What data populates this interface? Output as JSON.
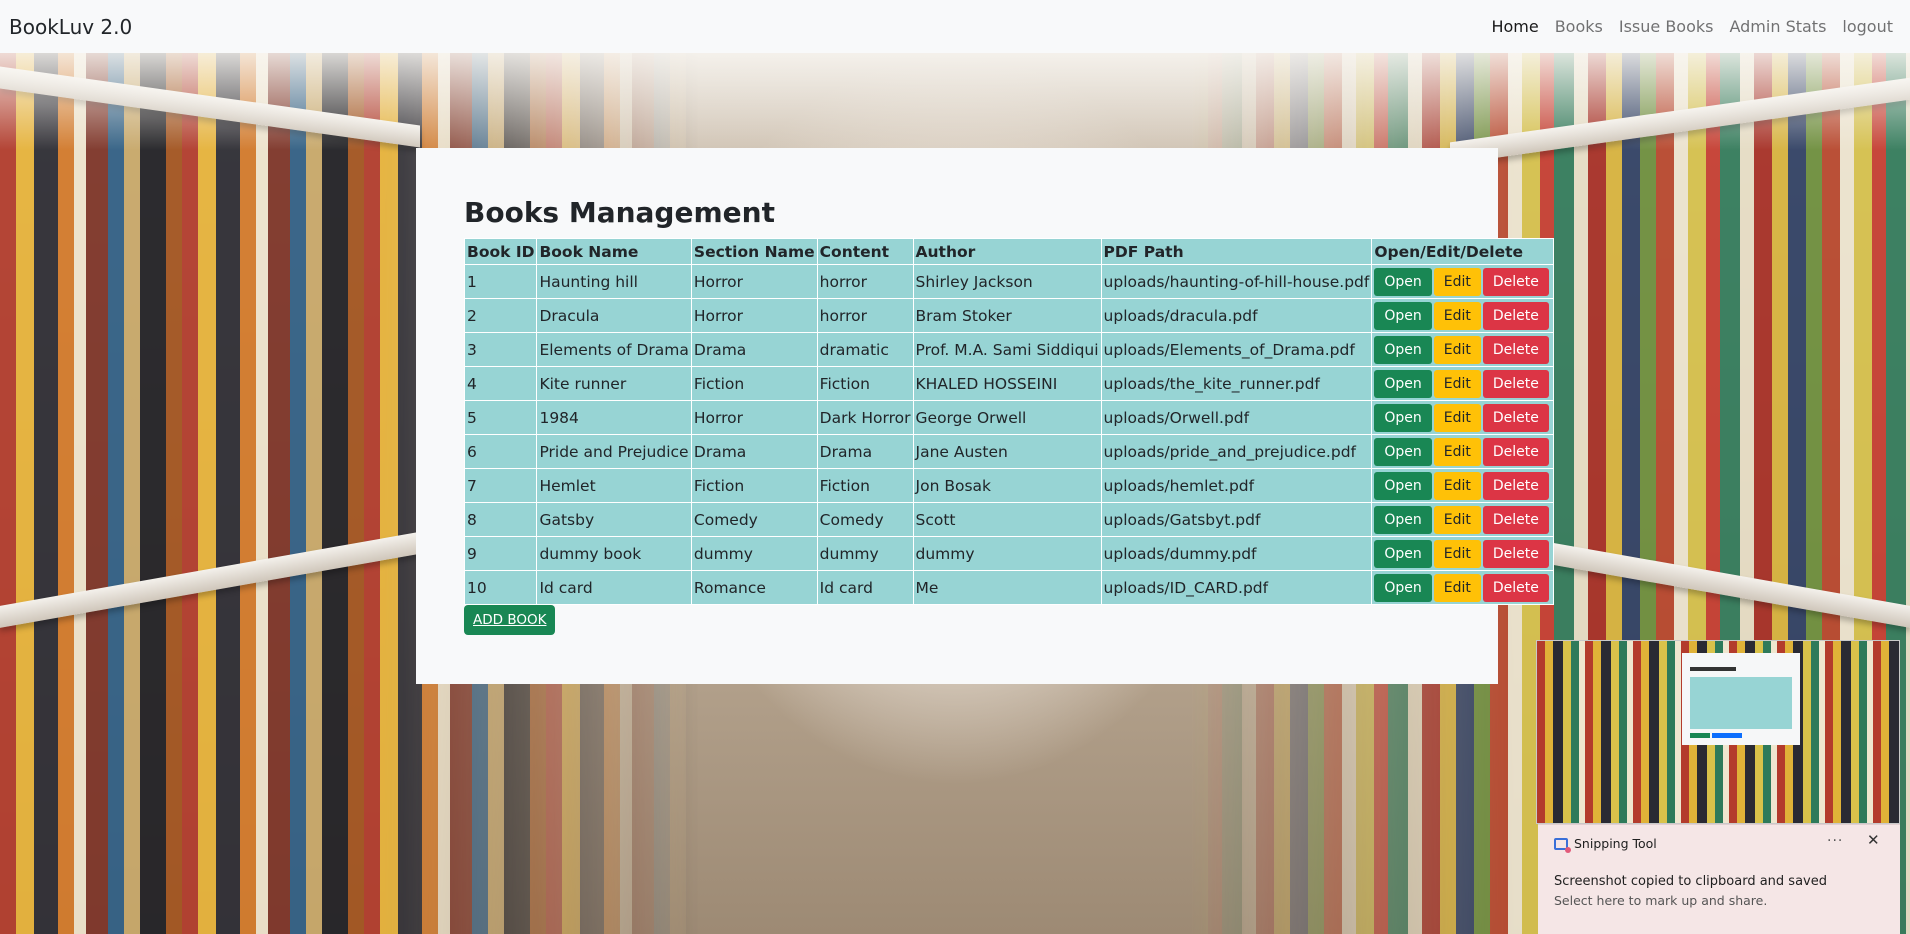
{
  "navbar": {
    "brand": "BookLuv 2.0",
    "links": [
      "Home",
      "Books",
      "Issue Books",
      "Admin Stats",
      "logout"
    ]
  },
  "main": {
    "title": "Books Management",
    "columns": [
      "Book ID",
      "Book Name",
      "Section Name",
      "Content",
      "Author",
      "PDF Path",
      "Open/Edit/Delete"
    ],
    "rows": [
      {
        "id": "1",
        "name": "Haunting hill",
        "section": "Horror",
        "content": "horror",
        "author": "Shirley Jackson",
        "pdf": "uploads/haunting-of-hill-house.pdf"
      },
      {
        "id": "2",
        "name": "Dracula",
        "section": "Horror",
        "content": "horror",
        "author": "Bram Stoker",
        "pdf": "uploads/dracula.pdf"
      },
      {
        "id": "3",
        "name": "Elements of Drama",
        "section": "Drama",
        "content": "dramatic",
        "author": "Prof. M.A. Sami Siddiqui",
        "pdf": "uploads/Elements_of_Drama.pdf"
      },
      {
        "id": "4",
        "name": "Kite runner",
        "section": "Fiction",
        "content": "Fiction",
        "author": "KHALED HOSSEINI",
        "pdf": "uploads/the_kite_runner.pdf"
      },
      {
        "id": "5",
        "name": "1984",
        "section": "Horror",
        "content": "Dark Horror",
        "author": "George Orwell",
        "pdf": "uploads/Orwell.pdf"
      },
      {
        "id": "6",
        "name": "Pride and Prejudice",
        "section": "Drama",
        "content": "Drama",
        "author": "Jane Austen",
        "pdf": "uploads/pride_and_prejudice.pdf"
      },
      {
        "id": "7",
        "name": "Hemlet",
        "section": "Fiction",
        "content": "Fiction",
        "author": "Jon Bosak",
        "pdf": "uploads/hemlet.pdf"
      },
      {
        "id": "8",
        "name": "Gatsby",
        "section": "Comedy",
        "content": "Comedy",
        "author": "Scott",
        "pdf": "uploads/Gatsbyt.pdf"
      },
      {
        "id": "9",
        "name": "dummy book",
        "section": "dummy",
        "content": "dummy",
        "author": "dummy",
        "pdf": "uploads/dummy.pdf"
      },
      {
        "id": "10",
        "name": "Id card",
        "section": "Romance",
        "content": "Id card",
        "author": "Me",
        "pdf": "uploads/ID_CARD.pdf"
      }
    ],
    "actions": {
      "open": "Open",
      "edit": "Edit",
      "delete": "Delete"
    },
    "add_button": "ADD BOOK"
  },
  "toast": {
    "app_name": "Snipping Tool",
    "more": "···",
    "close": "✕",
    "message": "Screenshot copied to clipboard and saved",
    "sub_message": "Select here to mark up and share."
  },
  "colors": {
    "table_cell": "#97d4d4",
    "open_button": "#198754",
    "edit_button": "#ffc107",
    "delete_button": "#dc3545",
    "card_bg": "#f8f9fa"
  }
}
